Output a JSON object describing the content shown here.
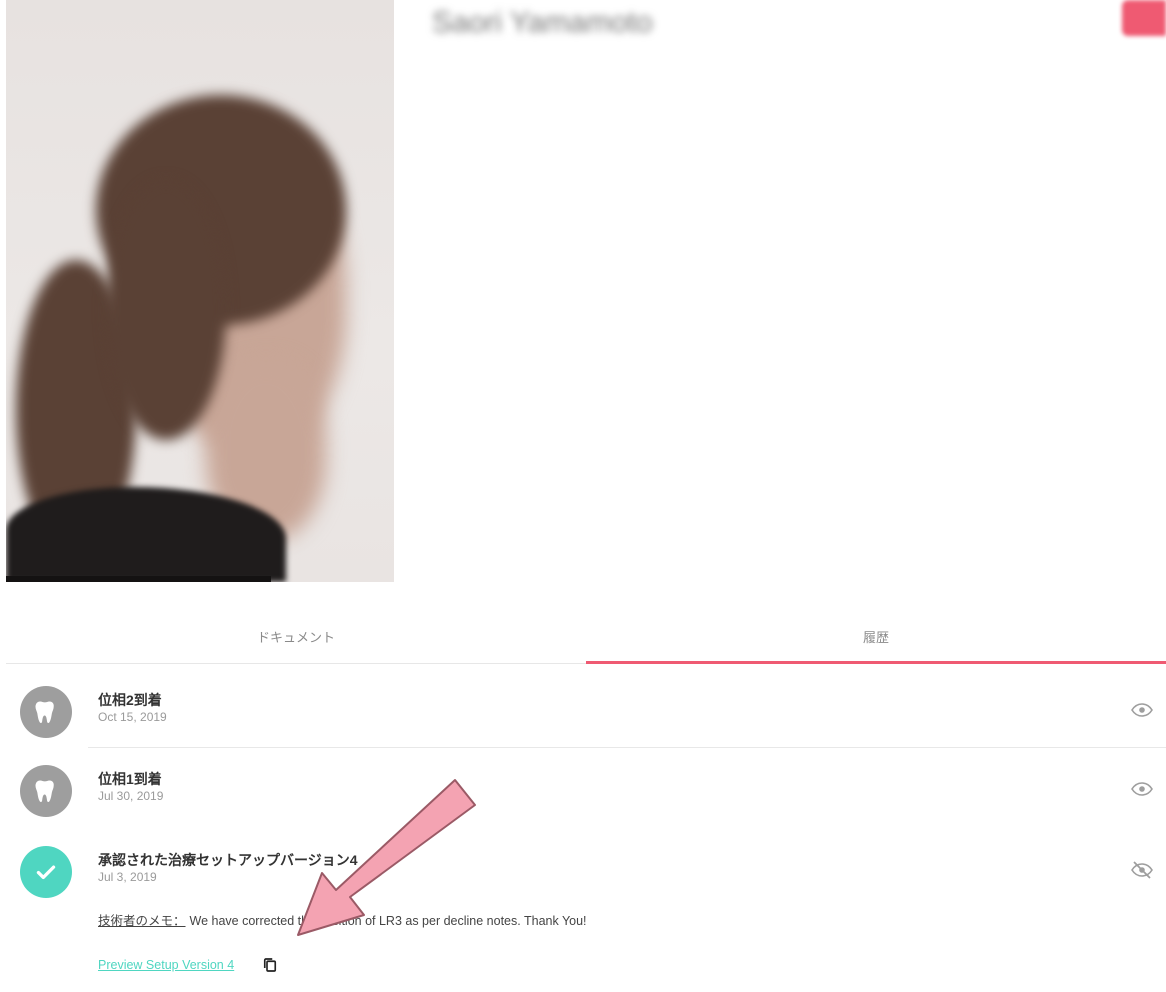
{
  "profile": {
    "name": "Saori Yamamoto",
    "subtitle": "",
    "info_left": [
      "",
      "",
      ""
    ],
    "info_right": [
      "",
      "",
      "",
      ""
    ]
  },
  "tabs": [
    {
      "label": "ドキュメント",
      "active": false
    },
    {
      "label": "履歴",
      "active": true
    }
  ],
  "history": [
    {
      "title": "位相2到着",
      "date": "Oct 15, 2019",
      "icon": "tooth-icon",
      "visibility": "eye-icon"
    },
    {
      "title": "位相1到着",
      "date": "Jul 30, 2019",
      "icon": "tooth-icon",
      "visibility": "eye-icon"
    },
    {
      "title": "承認された治療セットアップバージョン4",
      "date": "Jul 3, 2019",
      "icon": "check-icon",
      "visibility": "eye-off-icon",
      "note_label": "技術者のメモ：",
      "note_text": "We have corrected the position of LR3 as per decline notes. Thank You!",
      "preview_link": "Preview Setup Version 4"
    }
  ],
  "colors": {
    "accent": "#ef5a72",
    "teal": "#4fd6c1",
    "gray": "#9e9e9e",
    "arrow": "#f4a3b2"
  }
}
